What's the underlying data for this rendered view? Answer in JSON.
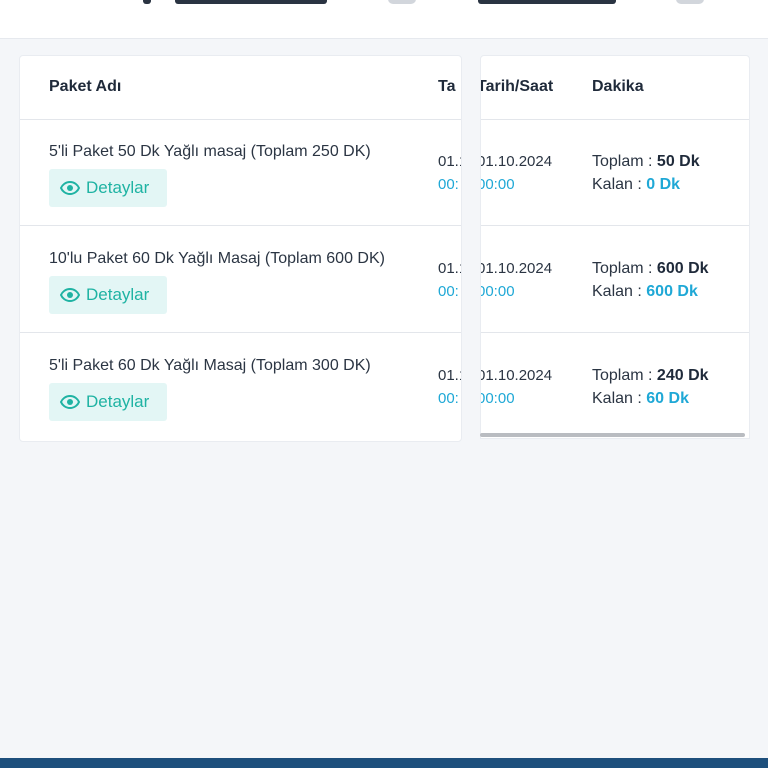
{
  "table": {
    "headers": {
      "package_name": "Paket Adı",
      "date_clipped": "Ta",
      "date_time": "Tarih/Saat",
      "minutes": "Dakika"
    },
    "detail_label": "Detaylar",
    "total_label": "Toplam :",
    "remaining_label": "Kalan :",
    "rows": [
      {
        "name": "5'li Paket 50 Dk Yağlı masaj (Toplam 250 DK)",
        "date_clipped": "01.1",
        "time_clipped": "00:",
        "date": "01.10.2024",
        "time": "00:00",
        "total": "50 Dk",
        "remaining": "0 Dk"
      },
      {
        "name": "10'lu Paket 60 Dk Yağlı Masaj (Toplam 600 DK)",
        "date_clipped": "01.1",
        "time_clipped": "00:",
        "date": "01.10.2024",
        "time": "00:00",
        "total": "600 Dk",
        "remaining": "600 Dk"
      },
      {
        "name": "5'li Paket 60 Dk Yağlı Masaj (Toplam 300 DK)",
        "date_clipped": "01.1",
        "time_clipped": "00:",
        "date": "01.10.2024",
        "time": "00:00",
        "total": "240 Dk",
        "remaining": "60 Dk"
      }
    ]
  },
  "icons": {
    "detail": "eye-icon"
  },
  "colors": {
    "accent_teal": "#1fb3a3",
    "accent_blue": "#1fa8d6",
    "bottom_bar": "#1d4f7c"
  }
}
